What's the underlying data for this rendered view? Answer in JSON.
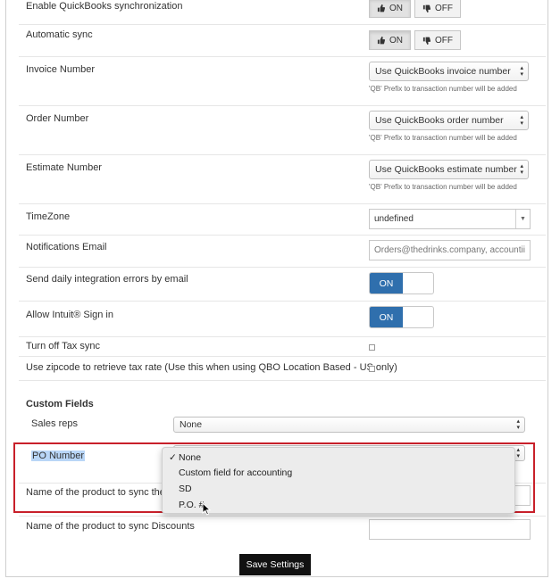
{
  "settings": {
    "enable_qb_sync": {
      "label": "Enable QuickBooks synchronization",
      "on_label": "ON",
      "off_label": "OFF"
    },
    "auto_sync": {
      "label": "Automatic sync",
      "on_label": "ON",
      "off_label": "OFF"
    },
    "invoice_number": {
      "label": "Invoice Number",
      "value": "Use QuickBooks invoice number",
      "hint": "'QB' Prefix to transaction number will be added"
    },
    "order_number": {
      "label": "Order Number",
      "value": "Use QuickBooks order number",
      "hint": "'QB' Prefix to transaction number will be added"
    },
    "estimate_number": {
      "label": "Estimate Number",
      "value": "Use QuickBooks estimate number",
      "hint": "'QB' Prefix to transaction number will be added"
    },
    "timezone": {
      "label": "TimeZone",
      "value": "undefined"
    },
    "notifications_email": {
      "label": "Notifications Email",
      "value": "Orders@thedrinks.company, accountii"
    },
    "daily_errors": {
      "label": "Send daily integration errors by email",
      "switch_label": "ON"
    },
    "intuit_signin": {
      "label": "Allow Intuit® Sign in",
      "switch_label": "ON"
    },
    "tax_sync": {
      "label": "Turn off Tax sync"
    },
    "zipcode": {
      "label": "Use zipcode to retrieve tax rate (Use this when using QBO Location Based - US only)"
    }
  },
  "custom_fields": {
    "title": "Custom Fields",
    "sales_reps": {
      "label": "Sales reps",
      "value": "None"
    },
    "po_number": {
      "label": "PO Number"
    },
    "shipping_product": {
      "label": "Name of the product to sync the Shi"
    },
    "discounts_product": {
      "label": "Name of the product to sync Discounts"
    }
  },
  "dropdown": {
    "options": [
      {
        "label": "None",
        "checked": true
      },
      {
        "label": "Custom field for accounting",
        "checked": false
      },
      {
        "label": "SD",
        "checked": false
      },
      {
        "label": "P.O. #",
        "checked": false
      }
    ],
    "check_mark": "✓"
  },
  "actions": {
    "save_label": "Save Settings"
  },
  "colors": {
    "primary": "#2f6fad",
    "highlight_border": "#c8202a",
    "selection": "#b9d6f7",
    "save_button": "#111111"
  }
}
